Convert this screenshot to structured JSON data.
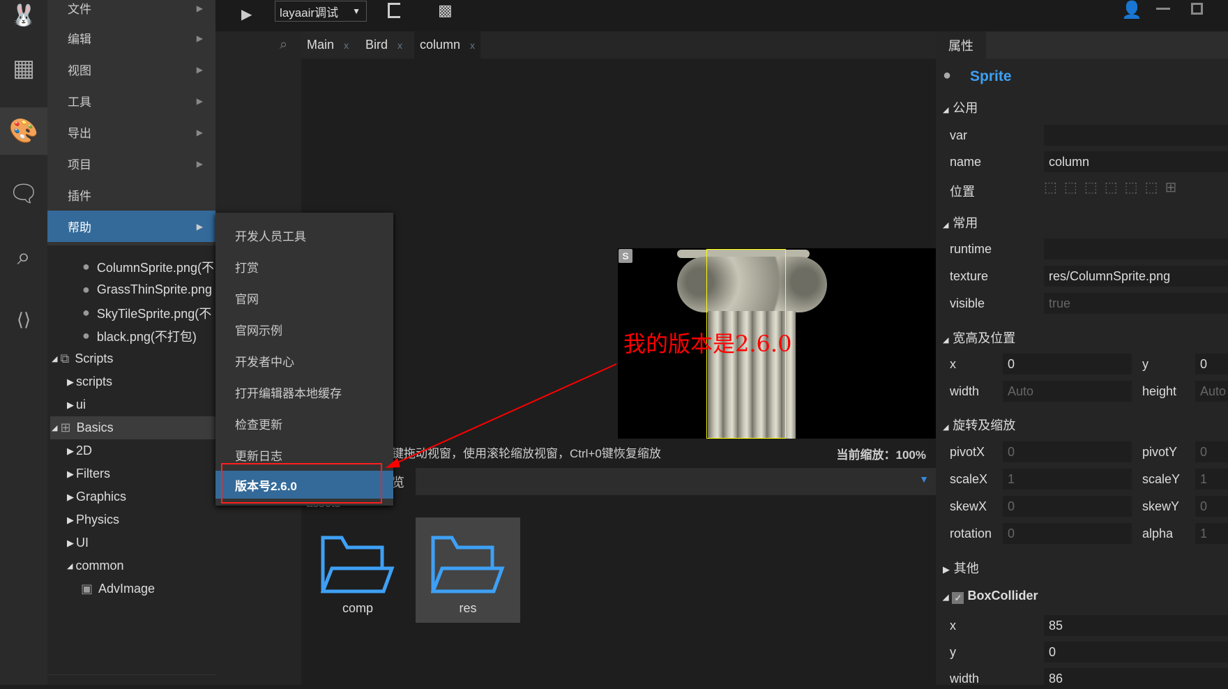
{
  "toolbar": {
    "run_config": "layaair调试"
  },
  "menu": {
    "items": [
      {
        "label": "文件"
      },
      {
        "label": "编辑"
      },
      {
        "label": "视图"
      },
      {
        "label": "工具"
      },
      {
        "label": "导出"
      },
      {
        "label": "项目"
      },
      {
        "label": "插件"
      },
      {
        "label": "帮助"
      }
    ]
  },
  "help_submenu": {
    "items": [
      {
        "label": "开发人员工具"
      },
      {
        "label": "打赏"
      },
      {
        "label": "官网"
      },
      {
        "label": "官网示例"
      },
      {
        "label": "开发者中心"
      },
      {
        "label": "打开编辑器本地缓存"
      },
      {
        "label": "检查更新"
      },
      {
        "label": "更新日志"
      },
      {
        "label": "版本号2.6.0"
      }
    ]
  },
  "tree": {
    "items": [
      {
        "label": "ColumnSprite.png(不"
      },
      {
        "label": "GrassThinSprite.png"
      },
      {
        "label": "SkyTileSprite.png(不"
      },
      {
        "label": "black.png(不打包)"
      },
      {
        "label": "Scripts"
      },
      {
        "label": "scripts"
      },
      {
        "label": "ui"
      },
      {
        "label": "Basics"
      },
      {
        "label": "2D"
      },
      {
        "label": "Filters"
      },
      {
        "label": "Graphics"
      },
      {
        "label": "Physics"
      },
      {
        "label": "UI"
      },
      {
        "label": "common"
      },
      {
        "label": "AdvImage"
      }
    ]
  },
  "tabs": [
    {
      "label": "Main"
    },
    {
      "label": "Bird"
    },
    {
      "label": "column"
    }
  ],
  "tab_close": "x",
  "canvas": {
    "badge": "S",
    "annotation": "我的版本是2.6.0"
  },
  "status": {
    "hint": "键拖动视窗，使用滚轮缩放视窗，Ctrl+0键恢复缩放",
    "zoom_label": "当前缩放：",
    "zoom_value": "100%"
  },
  "resources": {
    "tab_partial": "览",
    "path": "assets",
    "folders": [
      {
        "label": "comp"
      },
      {
        "label": "res"
      }
    ]
  },
  "props": {
    "tab": "属性",
    "component": "Sprite",
    "sections": {
      "common": "公用",
      "frequent": "常用",
      "size_pos": "宽高及位置",
      "rot_scale": "旋转及缩放",
      "other": "其他",
      "box": "BoxCollider"
    },
    "var": {
      "label": "var",
      "value": ""
    },
    "name": {
      "label": "name",
      "value": "column"
    },
    "position": {
      "label": "位置"
    },
    "runtime": {
      "label": "runtime",
      "value": ""
    },
    "texture": {
      "label": "texture",
      "value": "res/ColumnSprite.png"
    },
    "visible": {
      "label": "visible",
      "value": "true"
    },
    "x": {
      "label": "x",
      "value": "0"
    },
    "y": {
      "label": "y",
      "value": "0"
    },
    "width": {
      "label": "width",
      "value": "Auto"
    },
    "height": {
      "label": "height",
      "value": "Auto"
    },
    "pivotX": {
      "label": "pivotX",
      "value": "0"
    },
    "pivotY": {
      "label": "pivotY",
      "value": "0"
    },
    "scaleX": {
      "label": "scaleX",
      "value": "1"
    },
    "scaleY": {
      "label": "scaleY",
      "value": "1"
    },
    "skewX": {
      "label": "skewX",
      "value": "0"
    },
    "skewY": {
      "label": "skewY",
      "value": "0"
    },
    "rotation": {
      "label": "rotation",
      "value": "0"
    },
    "alpha": {
      "label": "alpha",
      "value": "1"
    },
    "box_x": {
      "label": "x",
      "value": "85"
    },
    "box_y": {
      "label": "y",
      "value": "0"
    },
    "box_width": {
      "label": "width",
      "value": "86"
    }
  },
  "colors": {
    "accent": "#346a99",
    "component_title": "#3ea0f5",
    "annotation": "#ff0000",
    "selection": "#ffff00"
  }
}
